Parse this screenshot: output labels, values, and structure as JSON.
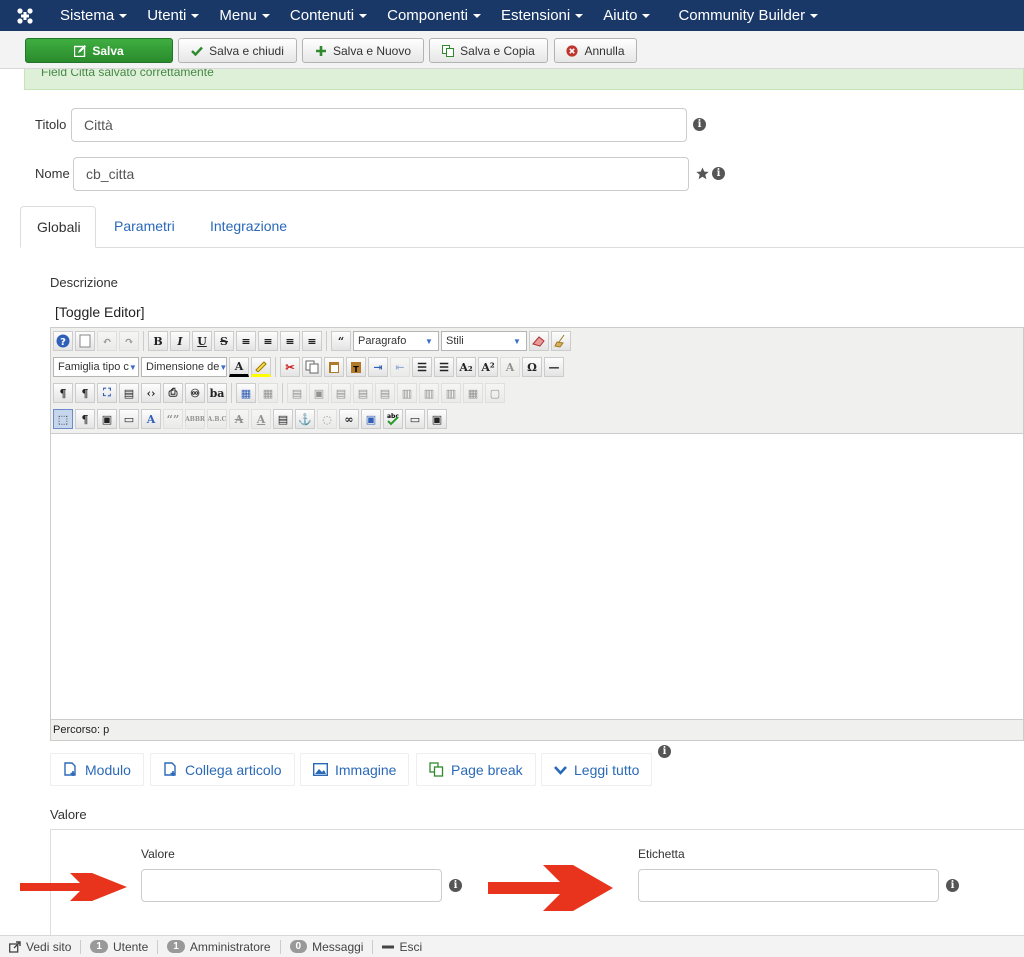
{
  "navbar": {
    "menus": [
      "Sistema",
      "Utenti",
      "Menu",
      "Contenuti",
      "Componenti",
      "Estensioni",
      "Aiuto",
      "Community Builder"
    ]
  },
  "toolbar": {
    "save": "Salva",
    "save_close": "Salva e chiudi",
    "save_new": "Salva e Nuovo",
    "save_copy": "Salva e Copia",
    "cancel": "Annulla"
  },
  "alert": {
    "message": "Field Città salvato correttamente"
  },
  "form": {
    "title_label": "Titolo",
    "title_value": "Città",
    "name_label": "Nome",
    "name_value": "cb_citta"
  },
  "tabs": [
    "Globali",
    "Parametri",
    "Integrazione"
  ],
  "editor": {
    "description_label": "Descrizione",
    "toggle": "[Toggle Editor]",
    "format_select": "Paragrafo",
    "styles_select": "Stili",
    "font_family": "Famiglia tipo c",
    "font_size": "Dimensione de",
    "path_label": "Percorso:",
    "path_value": "p"
  },
  "editor_buttons": [
    "Modulo",
    "Collega articolo",
    "Immagine",
    "Page break",
    "Leggi tutto"
  ],
  "value_section": {
    "heading": "Valore",
    "value_label": "Valore",
    "label_label": "Etichetta",
    "value_input": "",
    "label_input": ""
  },
  "statusbar": {
    "view_site": "Vedi sito",
    "users_count": "1",
    "users_label": "Utente",
    "admins_count": "1",
    "admins_label": "Amministratore",
    "messages_count": "0",
    "messages_label": "Messaggi",
    "logout": "Esci"
  },
  "colors": {
    "navbar": "#1a3867",
    "save_button": "#2f9a31",
    "link": "#2a69b8",
    "arrow": "#e8341c"
  }
}
